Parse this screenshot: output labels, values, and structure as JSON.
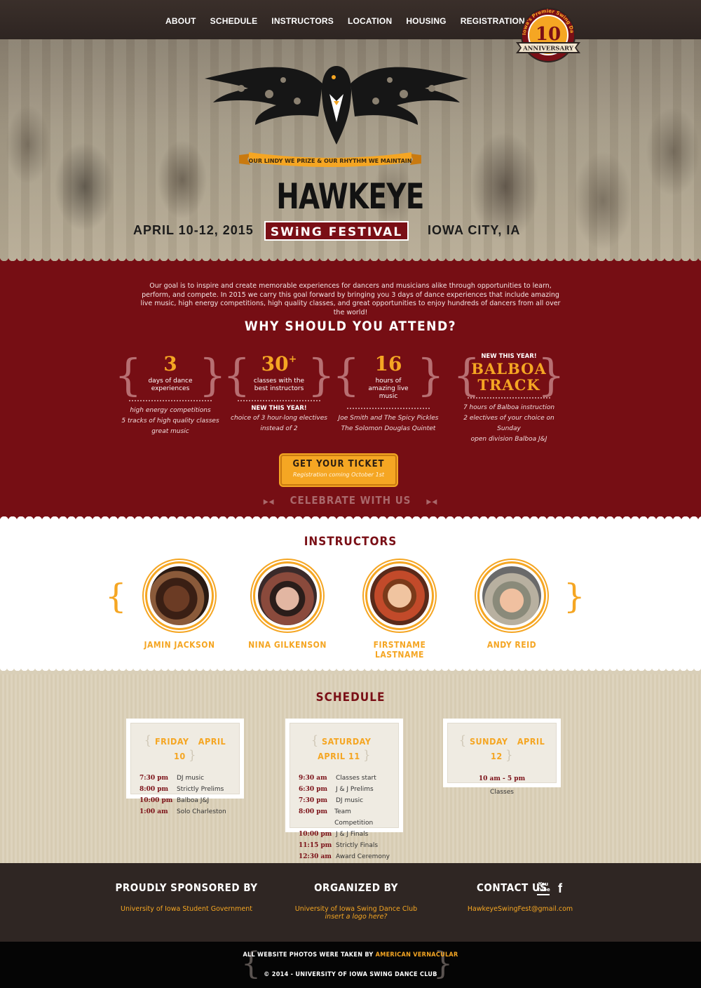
{
  "nav": {
    "items": [
      "ABOUT",
      "SCHEDULE",
      "INSTRUCTORS",
      "LOCATION",
      "HOUSING",
      "REGISTRATION"
    ]
  },
  "badge": {
    "number": "10",
    "ring_text": "Iowa's Premier Swing Dance Camp",
    "ribbon": "ANNIVERSARY"
  },
  "hero": {
    "motto": "OUR LINDY WE PRIZE & OUR RHYTHM WE MAINTAIN",
    "title": "HAWKEYE",
    "subtitle": "SWiNG FESTIVAL",
    "date": "APRIL 10-12, 2015",
    "city": "IOWA CITY, IA"
  },
  "why": {
    "intro": "Our goal is to inspire and create memorable experiences for dancers and musicians alike through opportunities to learn, perform, and compete. In 2015 we carry this goal forward by bringing you 3 days of dance experiences that include amazing live music, high energy competitions, high quality classes, and great opportunities to enjoy hundreds of dancers from all over the world!",
    "heading": "WHY SHOULD YOU ATTEND?",
    "stats": [
      {
        "num": "3",
        "label": "days of dance experiences",
        "notes": [
          "high energy competitions",
          "5 tracks of high quality classes",
          "great music"
        ]
      },
      {
        "num": "30",
        "plus": "+",
        "label": "classes with the best instructors",
        "new_tag": "NEW THIS YEAR!",
        "notes": [
          "choice of 3 hour-long electives",
          "instead of 2"
        ]
      },
      {
        "num": "16",
        "label": "hours of amazing live music",
        "notes": [
          "Joe Smith and The Spicy Pickles",
          "The Solomon Douglas Quintet"
        ]
      },
      {
        "new_top": "NEW THIS YEAR!",
        "big1": "BALBOA",
        "big2": "TRACK",
        "notes": [
          "7 hours of Balboa instruction",
          "2 electives of your choice on Sunday",
          "open division Balboa J&J"
        ]
      }
    ],
    "ticket_label": "GET YOUR TICKET",
    "ticket_sub": "Registration coming October 1st",
    "celebrate": "CELEBRATE WITH US"
  },
  "instructors": {
    "heading": "INSTRUCTORS",
    "people": [
      {
        "name": "JAMIN JACKSON"
      },
      {
        "name": "NINA GILKENSON"
      },
      {
        "name": "FIRSTNAME LASTNAME"
      },
      {
        "name": "ANDY REID"
      }
    ]
  },
  "schedule": {
    "heading": "SCHEDULE",
    "days": [
      {
        "day": "FRIDAY",
        "date": "APRIL 10",
        "rows": [
          {
            "time": "7:30 pm",
            "event": "DJ music"
          },
          {
            "time": "8:00 pm",
            "event": "Strictly Prelims"
          },
          {
            "time": "10:00 pm",
            "event": "Balboa J&J"
          },
          {
            "time": "1:00 am",
            "event": "Solo Charleston"
          }
        ]
      },
      {
        "day": "SATURDAY",
        "date": "APRIL 11",
        "rows": [
          {
            "time": "9:30 am",
            "event": "Classes start"
          },
          {
            "time": "6:30 pm",
            "event": "J & J Prelims"
          },
          {
            "time": "7:30 pm",
            "event": "DJ music"
          },
          {
            "time": "8:00 pm",
            "event": "Team Competition"
          },
          {
            "time": "10:00 pm",
            "event": "J & J Finals"
          },
          {
            "time": "11:15 pm",
            "event": "Strictly Finals"
          },
          {
            "time": "12:30 am",
            "event": "Award Ceremony"
          }
        ]
      },
      {
        "day": "SUNDAY",
        "date": "APRIL 12",
        "time": "10 am - 5 pm",
        "event": "Classes"
      }
    ]
  },
  "footer": {
    "sponsor_heading": "PROUDLY SPONSORED BY",
    "sponsor_link": "University of Iowa Student Government",
    "organizer_heading": "ORGANIZED BY",
    "organizer_link": "University of Iowa Swing Dance Club",
    "organizer_logo_note": "insert a logo here?",
    "contact_heading": "CONTACT US",
    "contact_email": "HawkeyeSwingFest@gmail.com",
    "social_icons": [
      "youtube-icon",
      "facebook-icon"
    ],
    "youtube_label": "You Tube",
    "facebook_label": "f",
    "photos_prefix": "ALL WEBSITE PHOTOS WERE TAKEN BY",
    "photos_credit": "AMERICAN VERNACULAR",
    "copyright": "© 2014 - UNIVERSITY OF IOWA SWING DANCE CLUB"
  },
  "colors": {
    "maroon": "#760e14",
    "gold": "#f5a623",
    "dark": "#2f2623",
    "beige": "#d9cfb8"
  }
}
